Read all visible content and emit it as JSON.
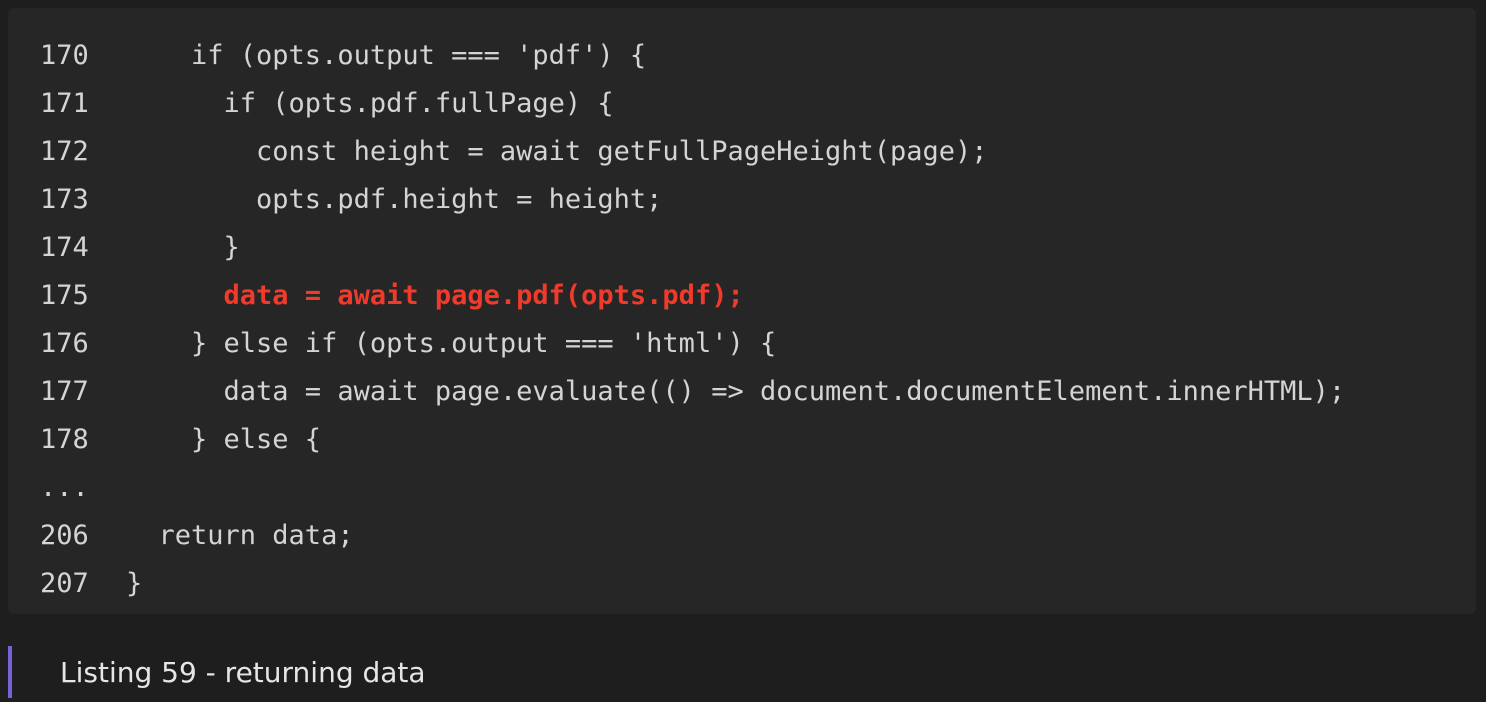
{
  "code": {
    "lines": [
      {
        "number": "170",
        "text": "    if (opts.output === 'pdf') {"
      },
      {
        "number": "171",
        "text": "      if (opts.pdf.fullPage) {"
      },
      {
        "number": "172",
        "text": "        const height = await getFullPageHeight(page);"
      },
      {
        "number": "173",
        "text": "        opts.pdf.height = height;"
      },
      {
        "number": "174",
        "text": "      }"
      },
      {
        "number": "175",
        "text": "      data = await page.pdf(opts.pdf);"
      },
      {
        "number": "176",
        "text": "    } else if (opts.output === 'html') {"
      },
      {
        "number": "177",
        "text": "      data = await page.evaluate(() => document.documentElement.innerHTML);"
      },
      {
        "number": "178",
        "text": "    } else {"
      },
      {
        "number": "...",
        "text": ""
      },
      {
        "number": "206",
        "text": "  return data;"
      },
      {
        "number": "207",
        "text": "}"
      }
    ],
    "highlight_color": "#f03a2b"
  },
  "caption": {
    "text": "Listing 59 - returning data",
    "accent_color": "#7b61d6"
  }
}
